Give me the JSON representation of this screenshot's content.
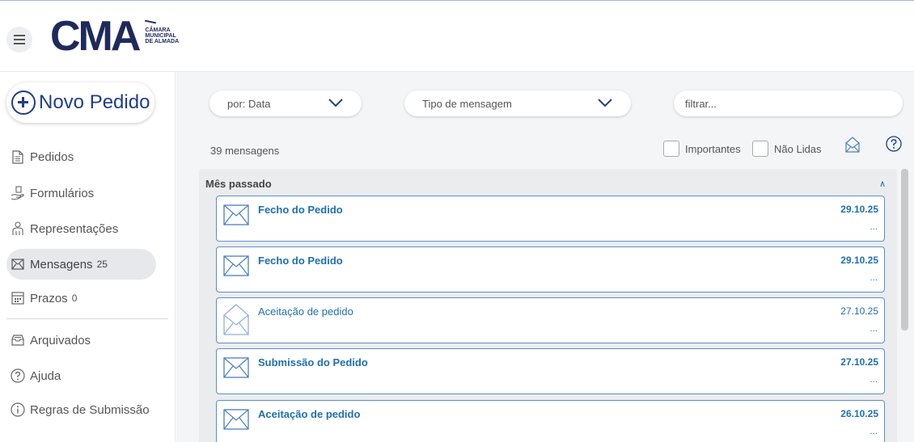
{
  "header": {
    "logo_text": "CMA",
    "logo_line1": "CÂMARA",
    "logo_line2": "MUNICIPAL",
    "logo_line3": "DE ALMADA"
  },
  "sidebar": {
    "new_button_label": "Novo Pedido",
    "items": [
      {
        "label": "Pedidos",
        "icon": "document-icon",
        "count": ""
      },
      {
        "label": "Formulários",
        "icon": "hand-form-icon",
        "count": ""
      },
      {
        "label": "Representações",
        "icon": "people-icon",
        "count": ""
      },
      {
        "label": "Mensagens",
        "icon": "envelope-icon",
        "count": "25"
      },
      {
        "label": "Prazos",
        "icon": "calendar-icon",
        "count": "0"
      },
      {
        "label": "Arquivados",
        "icon": "archive-icon",
        "count": ""
      },
      {
        "label": "Ajuda",
        "icon": "help-icon",
        "count": ""
      },
      {
        "label": "Regras de Submissão",
        "icon": "info-icon",
        "count": ""
      }
    ]
  },
  "filters": {
    "sort_value": "por: Data",
    "type_value": "Tipo de mensagem",
    "filter_placeholder": "filtrar..."
  },
  "toolbar": {
    "count_text": "39 mensagens",
    "important_label": "Importantes",
    "unread_label": "Não Lidas"
  },
  "list": {
    "group_title": "Mês passado",
    "messages": [
      {
        "title": "Fecho do Pedido",
        "date": "29.10.25",
        "unread": true,
        "more": "..."
      },
      {
        "title": "Fecho do Pedido",
        "date": "29.10.25",
        "unread": true,
        "more": "..."
      },
      {
        "title": "Aceitação de pedido",
        "date": "27.10.25",
        "unread": false,
        "more": "..."
      },
      {
        "title": "Submissão do Pedido",
        "date": "27.10.25",
        "unread": true,
        "more": "..."
      },
      {
        "title": "Aceitação de pedido",
        "date": "26.10.25",
        "unread": true,
        "more": "..."
      }
    ]
  },
  "colors": {
    "brand": "#1f2a5c",
    "accent": "#1f6fb0",
    "card_border": "#5a8fd0"
  }
}
